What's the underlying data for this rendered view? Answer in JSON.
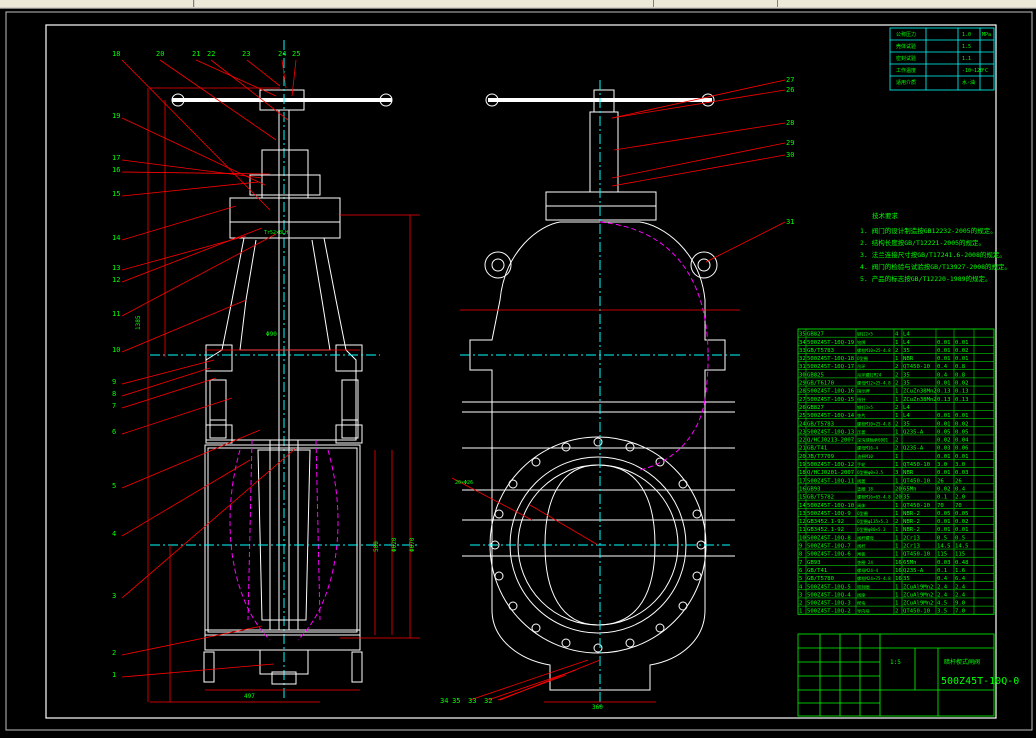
{
  "window": {
    "tabs": [
      "",
      "",
      "",
      "",
      "",
      ""
    ]
  },
  "spec_table": {
    "rows": [
      {
        "label": "公称压力",
        "value": "1.0",
        "unit": "MPa"
      },
      {
        "label": "壳体试验",
        "value": "1.5",
        "unit": ""
      },
      {
        "label": "密封试验",
        "value": "1.1",
        "unit": ""
      },
      {
        "label": "工作温度",
        "value": "-10~120",
        "unit": "°C"
      },
      {
        "label": "适用介质",
        "value": "水·油",
        "unit": ""
      }
    ]
  },
  "tech_req": {
    "title": "技术要求",
    "items": [
      "1. 阀门的设计制造按GB12232-2005的规定。",
      "2. 结构长度按GB/T12221-2005的规定。",
      "3. 法兰连接尺寸按GB/T17241.6-2008的规定。",
      "4. 阀门的检验与试验按GB/T13927-2008的规定。",
      "5. 产品的标志按GB/T12220-1989的规定。"
    ]
  },
  "callouts_left": [
    "18",
    "20",
    "21",
    "22",
    "23",
    "24",
    "25",
    "19",
    "17",
    "16",
    "15",
    "14",
    "13",
    "12",
    "11",
    "10",
    "9",
    "8",
    "7",
    "6",
    "5",
    "4",
    "3",
    "2",
    "1"
  ],
  "callouts_right": [
    "27",
    "26",
    "28",
    "29",
    "30",
    "31"
  ],
  "callouts_bottom": [
    "34",
    "35",
    "33",
    "32"
  ],
  "dimensions": {
    "d_bottom_left": "497",
    "d_bottom_right": "360",
    "d_top": "Tr52×8LH",
    "d_mid": "Φ90",
    "d_height": "1385",
    "d_open": "500",
    "d_flange": "Φ670",
    "d_hole": "Φ620",
    "d_bolts": "20×Φ26"
  },
  "title_block": {
    "drawing_no": "500Z45T-10Q-0",
    "name": "暗杆楔式闸阀",
    "scale": "1:5"
  },
  "bom_rows": [
    [
      "35",
      "GB827",
      "铆钉2×5",
      "4",
      "L4",
      "",
      ""
    ],
    [
      "34",
      "500Z45T-10Q-19",
      "铭牌",
      "1",
      "L4",
      "0.01",
      "0.01"
    ],
    [
      "33",
      "GB/T5783",
      "螺栓M10×25-4.8",
      "2",
      "35",
      "0.01",
      "0.02"
    ],
    [
      "32",
      "500Z45T-10Q-18",
      "O型圈",
      "1",
      "NBR",
      "0.01",
      "0.01"
    ],
    [
      "31",
      "500Z45T-10Q-17",
      "吊环",
      "2",
      "QT450-10",
      "0.4",
      "0.8"
    ],
    [
      "30",
      "GB825",
      "吊环螺钉M24",
      "2",
      "35",
      "0.4",
      "0.8"
    ],
    [
      "29",
      "GB/T6170",
      "螺母M12×25-4.8",
      "2",
      "35",
      "0.01",
      "0.02"
    ],
    [
      "28",
      "500Z45T-10Q-16",
      "指示牌",
      "1",
      "ZCuZn38Mn2",
      "0.13",
      "0.13"
    ],
    [
      "27",
      "500Z45T-10Q-15",
      "指针",
      "1",
      "ZCuZn38Mn2",
      "0.13",
      "0.13"
    ],
    [
      "26",
      "GB827",
      "铆钉3×5",
      "2",
      "L4",
      "",
      ""
    ],
    [
      "25",
      "500Z45T-10Q-14",
      "垫片",
      "1",
      "L4",
      "0.01",
      "0.01"
    ],
    [
      "24",
      "GB/T5783",
      "螺栓M10×25-4.8",
      "2",
      "35",
      "0.01",
      "0.02"
    ],
    [
      "23",
      "500Z45T-10Q-13",
      "压盖",
      "1",
      "Q235-A",
      "0.05",
      "0.05"
    ],
    [
      "22",
      "Q/HCJ0213-2007",
      "深沟球轴承6001",
      "2",
      "",
      "0.02",
      "0.04"
    ],
    [
      "21",
      "GB/T41",
      "螺母M16-4",
      "2",
      "Q235-A",
      "0.03",
      "0.06"
    ],
    [
      "20",
      "JB/T7709",
      "油杯M10",
      "1",
      "",
      "0.01",
      "0.01"
    ],
    [
      "19",
      "500Z45T-10Q-12",
      "手轮",
      "1",
      "QT450-10",
      "3.0",
      "3.0"
    ],
    [
      "18",
      "Q/HCJ0201-2007",
      "O型圈φ0×3.5",
      "3",
      "NBR",
      "0.01",
      "0.03"
    ],
    [
      "17",
      "500Z45T-10Q-11",
      "阀盖",
      "1",
      "QT450-10",
      "26",
      "26"
    ],
    [
      "16",
      "GB93",
      "垫圈 18",
      "20",
      "65Mn",
      "0.02",
      "0.4"
    ],
    [
      "15",
      "GB/T5782",
      "螺栓M16×65-4.8",
      "20",
      "35",
      "0.1",
      "2.0"
    ],
    [
      "14",
      "500Z45T-10Q-10",
      "阀体",
      "1",
      "QT450-10",
      "70",
      "70"
    ],
    [
      "13",
      "500Z45T-10Q-9",
      "O型圈",
      "1",
      "NBR-2",
      "0.05",
      "0.05"
    ],
    [
      "12",
      "GB3452.1-92",
      "O型圈φ135×5.3",
      "2",
      "NBR-2",
      "0.01",
      "0.02"
    ],
    [
      "11",
      "GB3452.1-92",
      "O型圈φ80×5.3",
      "1",
      "NBR-2",
      "0.01",
      "0.01"
    ],
    [
      "10",
      "500Z45T-10Q-8",
      "阀杆螺母",
      "1",
      "2Cr13",
      "0.5",
      "0.5"
    ],
    [
      "9",
      "500Z45T-10Q-7",
      "阀杆",
      "1",
      "2Cr13",
      "14.5",
      "14.5"
    ],
    [
      "8",
      "500Z45T-10Q-6",
      "闸板",
      "1",
      "QT450-10",
      "115",
      "115"
    ],
    [
      "7",
      "GB93",
      "垫圈 24",
      "16",
      "65Mn",
      "0.03",
      "0.48"
    ],
    [
      "6",
      "GB/T41",
      "螺母M24-4",
      "16",
      "Q235-A",
      "0.1",
      "1.6"
    ],
    [
      "5",
      "GB/T5780",
      "螺栓M24×75-4.8",
      "16",
      "35",
      "0.4",
      "6.4"
    ],
    [
      "4",
      "500Z45T-10Q-5",
      "密封圈",
      "1",
      "ZCuAl9Mn2",
      "2.4",
      "2.4"
    ],
    [
      "3",
      "500Z45T-10Q-4",
      "阀座",
      "1",
      "ZCuAl9Mn2",
      "2.4",
      "2.4"
    ],
    [
      "2",
      "500Z45T-10Q-3",
      "楔块",
      "1",
      "ZCuAl9Mn2",
      "4.5",
      "9.0"
    ],
    [
      "1",
      "500Z45T-10Q-2",
      "导向块",
      "2",
      "QT450-10",
      "3.5",
      "7.0"
    ]
  ],
  "colors": {
    "frame": "#ffffff",
    "outline": "#ffffff",
    "dimension": "#ff0000",
    "center": "#00ffff",
    "hidden": "#ff00ff",
    "text": "#00ff00",
    "table": "#00ff00"
  }
}
